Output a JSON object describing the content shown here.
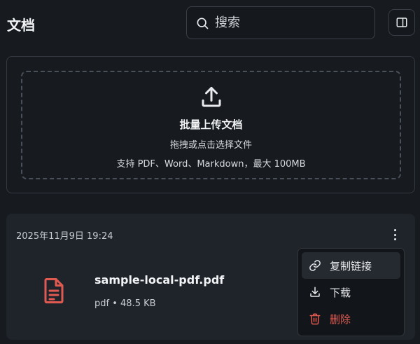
{
  "header": {
    "title": "文档",
    "search_placeholder": "搜索"
  },
  "upload": {
    "title": "批量上传文档",
    "subtitle": "拖拽或点击选择文件",
    "hint": "支持 PDF、Word、Markdown，最大 100MB"
  },
  "document": {
    "date": "2025年11月9日 19:24",
    "name": "sample-local-pdf.pdf",
    "meta": "pdf • 48.5 KB",
    "icon": "pdf-file-icon"
  },
  "context_menu": {
    "items": [
      {
        "label": "复制链接",
        "icon": "link-icon"
      },
      {
        "label": "下载",
        "icon": "download-icon"
      },
      {
        "label": "删除",
        "icon": "trash-icon"
      }
    ]
  },
  "colors": {
    "background": "#171a1f",
    "card": "#1f232a",
    "danger": "#e05a52",
    "file_icon": "#e05a52"
  }
}
